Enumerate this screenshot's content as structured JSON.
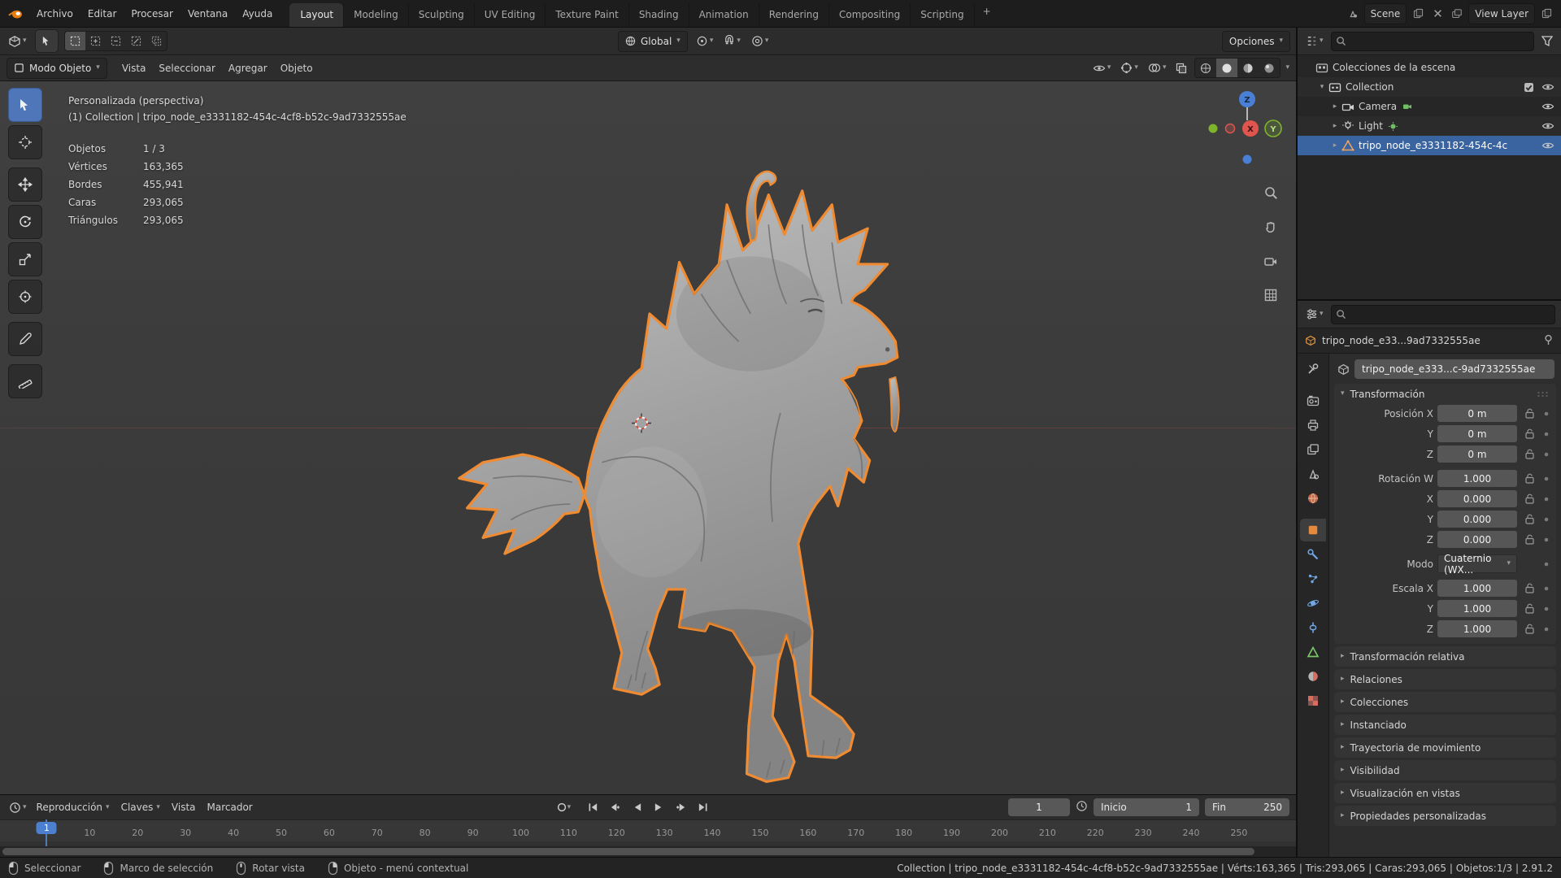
{
  "glyphs": {
    "chevron_down": "▾",
    "arrow_right": "▸",
    "arrow_down": "▾",
    "plus": "+"
  },
  "topbar": {
    "menus": [
      "Archivo",
      "Editar",
      "Procesar",
      "Ventana",
      "Ayuda"
    ],
    "workspaces": [
      "Layout",
      "Modeling",
      "Sculpting",
      "UV Editing",
      "Texture Paint",
      "Shading",
      "Animation",
      "Rendering",
      "Compositing",
      "Scripting"
    ],
    "active_workspace": "Layout",
    "new_workspace_label": "+",
    "scene_value": "Scene",
    "view_layer_value": "View Layer"
  },
  "tool_settings": {
    "orientation_value": "Global",
    "options_label": "Opciones"
  },
  "viewport_header": {
    "mode_value": "Modo Objeto",
    "menus": [
      "Vista",
      "Seleccionar",
      "Agregar",
      "Objeto"
    ]
  },
  "viewport": {
    "view_label": "Personalizada (perspectiva)",
    "collection_path": "(1) Collection | tripo_node_e3331182-454c-4cf8-b52c-9ad7332555ae",
    "stats": [
      {
        "label": "Objetos",
        "value": "1 / 3"
      },
      {
        "label": "Vértices",
        "value": "163,365"
      },
      {
        "label": "Bordes",
        "value": "455,941"
      },
      {
        "label": "Caras",
        "value": "293,065"
      },
      {
        "label": "Triángulos",
        "value": "293,065"
      }
    ]
  },
  "outliner": {
    "title_row": "Colecciones de la escena",
    "rows": [
      {
        "label": "Colecciones de la escena",
        "icon": "scene-collection",
        "level": 0,
        "arrow": "none",
        "right": []
      },
      {
        "label": "Collection",
        "icon": "collection",
        "level": 1,
        "arrow": "down",
        "right": [
          "checkbox",
          "eye"
        ]
      },
      {
        "label": "Camera",
        "icon": "camera",
        "level": 2,
        "arrow": "right",
        "badge": "camera-data",
        "right": [
          "eye"
        ]
      },
      {
        "label": "Light",
        "icon": "light",
        "level": 2,
        "arrow": "right",
        "badge": "light-data",
        "right": [
          "eye"
        ]
      },
      {
        "label": "tripo_node_e3331182-454c-4c",
        "icon": "mesh",
        "level": 2,
        "arrow": "right",
        "selected": true,
        "right": [
          "eye"
        ]
      }
    ]
  },
  "properties": {
    "breadcrumb_object": "tripo_node_e33...9ad7332555ae",
    "data_name": "tripo_node_e333...c-9ad7332555ae",
    "tabs": [
      {
        "id": "tool"
      },
      {
        "id": "render"
      },
      {
        "id": "output"
      },
      {
        "id": "view-layer"
      },
      {
        "id": "scene"
      },
      {
        "id": "world"
      },
      {
        "id": "object",
        "active": true
      },
      {
        "id": "modifiers"
      },
      {
        "id": "particles"
      },
      {
        "id": "physics"
      },
      {
        "id": "constraints"
      },
      {
        "id": "data"
      },
      {
        "id": "material"
      },
      {
        "id": "texture"
      }
    ],
    "transform_panel": {
      "title": "Transformación",
      "rows": [
        {
          "label": "Posición X",
          "value": "0 m",
          "kind": "number"
        },
        {
          "label": "Y",
          "value": "0 m",
          "kind": "number"
        },
        {
          "label": "Z",
          "value": "0 m",
          "kind": "number"
        },
        {
          "label": "Rotación W",
          "value": "1.000",
          "kind": "number"
        },
        {
          "label": "X",
          "value": "0.000",
          "kind": "number"
        },
        {
          "label": "Y",
          "value": "0.000",
          "kind": "number"
        },
        {
          "label": "Z",
          "value": "0.000",
          "kind": "number"
        },
        {
          "label": "Modo",
          "value": "Cuaternio (WX...",
          "kind": "menu"
        },
        {
          "label": "Escala X",
          "value": "1.000",
          "kind": "number"
        },
        {
          "label": "Y",
          "value": "1.000",
          "kind": "number"
        },
        {
          "label": "Z",
          "value": "1.000",
          "kind": "number"
        }
      ]
    },
    "collapsed_panels": [
      "Transformación relativa",
      "Relaciones",
      "Colecciones",
      "Instanciado",
      "Trayectoria de movimiento",
      "Visibilidad",
      "Visualización en vistas",
      "Propiedades personalizadas"
    ]
  },
  "timeline": {
    "menus": [
      {
        "label": "Reproducción",
        "dropdown": true
      },
      {
        "label": "Claves",
        "dropdown": true
      },
      {
        "label": "Vista",
        "dropdown": false
      },
      {
        "label": "Marcador",
        "dropdown": false
      }
    ],
    "current_frame": "1",
    "frame_start_label": "Inicio",
    "frame_start": "1",
    "frame_end_label": "Fin",
    "frame_end": "250",
    "ticks": [
      "10",
      "20",
      "30",
      "40",
      "50",
      "60",
      "70",
      "80",
      "90",
      "100",
      "110",
      "120",
      "130",
      "140",
      "150",
      "160",
      "170",
      "180",
      "190",
      "200",
      "210",
      "220",
      "230",
      "240",
      "250"
    ]
  },
  "statusbar": {
    "hints": [
      {
        "icon": "mouse-left",
        "label": "Seleccionar"
      },
      {
        "icon": "mouse-drag",
        "label": "Marco de selección"
      },
      {
        "icon": "mouse-middle",
        "label": "Rotar vista"
      },
      {
        "icon": "mouse-right",
        "label": "Objeto - menú contextual"
      }
    ],
    "info": "Collection | tripo_node_e3331182-454c-4cf8-b52c-9ad7332555ae | Vérts:163,365 | Tris:293,065 | Caras:293,065 | Objetos:1/3 | 2.91.2"
  }
}
